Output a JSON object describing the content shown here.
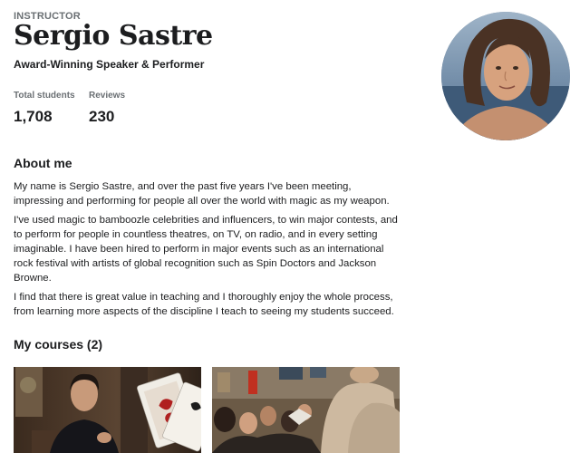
{
  "profile": {
    "eyebrow": "INSTRUCTOR",
    "name": "Sergio Sastre",
    "headline": "Award-Winning Speaker & Performer",
    "avatar_icon": "instructor-portrait"
  },
  "stats": {
    "students_label": "Total students",
    "students_value": "1,708",
    "reviews_label": "Reviews",
    "reviews_value": "230"
  },
  "about": {
    "title": "About me",
    "paragraphs": [
      "My name is Sergio Sastre, and over the past five years I've been meeting, impressing and performing for people all over the world with magic as my weapon.",
      "I've used magic to bamboozle celebrities and influencers, to win major contests, and to perform for people in countless theatres, on TV, on radio, and in every setting imaginable. I have been hired to perform in major events such as an international rock festival with artists of global recognition such as Spin Doctors and Jackson Browne.",
      "I find that there is great value in teaching and I thoroughly enjoy the whole process, from learning more aspects of the discipline I teach to seeing my students succeed."
    ]
  },
  "courses": {
    "title": "My courses (2)",
    "items": [
      {
        "thumbnail_icon": "magician-with-playing-cards-thumbnail"
      },
      {
        "thumbnail_icon": "stage-performance-crowd-thumbnail"
      }
    ]
  },
  "colors": {
    "text": "#1c1d1f",
    "muted": "#6a6f73",
    "background": "#ffffff"
  }
}
